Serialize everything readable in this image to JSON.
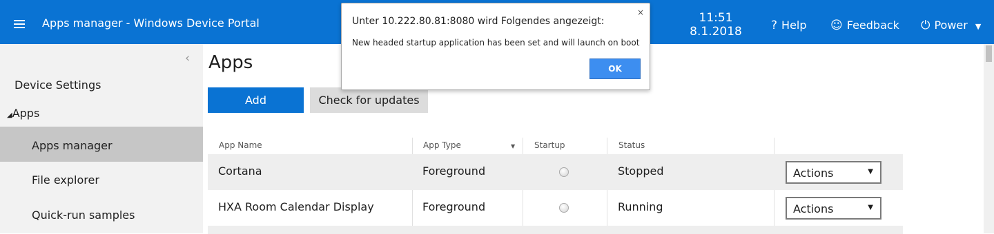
{
  "header": {
    "title": "Apps manager - Windows Device Portal",
    "time": "11:51",
    "date": "8.1.2018",
    "help_label": "Help",
    "feedback_label": "Feedback",
    "power_label": "Power",
    "background_color": "#0a73d3"
  },
  "sidebar": {
    "items": [
      {
        "label": "Device Settings"
      },
      {
        "label": "Apps"
      },
      {
        "label": "Apps manager"
      },
      {
        "label": "File explorer"
      },
      {
        "label": "Quick-run samples"
      }
    ],
    "selected": "Apps manager"
  },
  "main": {
    "title": "Apps",
    "add_label": "Add",
    "check_updates_label": "Check for updates"
  },
  "table": {
    "columns": [
      "App Name",
      "App Type",
      "Startup",
      "Status"
    ],
    "rows": [
      {
        "name": "Cortana",
        "type": "Foreground",
        "status": "Stopped",
        "action": "Actions"
      },
      {
        "name": "HXA Room Calendar Display",
        "type": "Foreground",
        "status": "Running",
        "action": "Actions"
      }
    ]
  },
  "dialog": {
    "title": "Unter 10.222.80.81:8080 wird Folgendes angezeigt:",
    "message": "New headed startup application has been set and will launch on boot",
    "ok_label": "OK",
    "close_icon": "×"
  },
  "icons": {
    "menu": "menu-icon",
    "help": "question-icon",
    "feedback": "smiley-icon",
    "power": "power-icon"
  }
}
